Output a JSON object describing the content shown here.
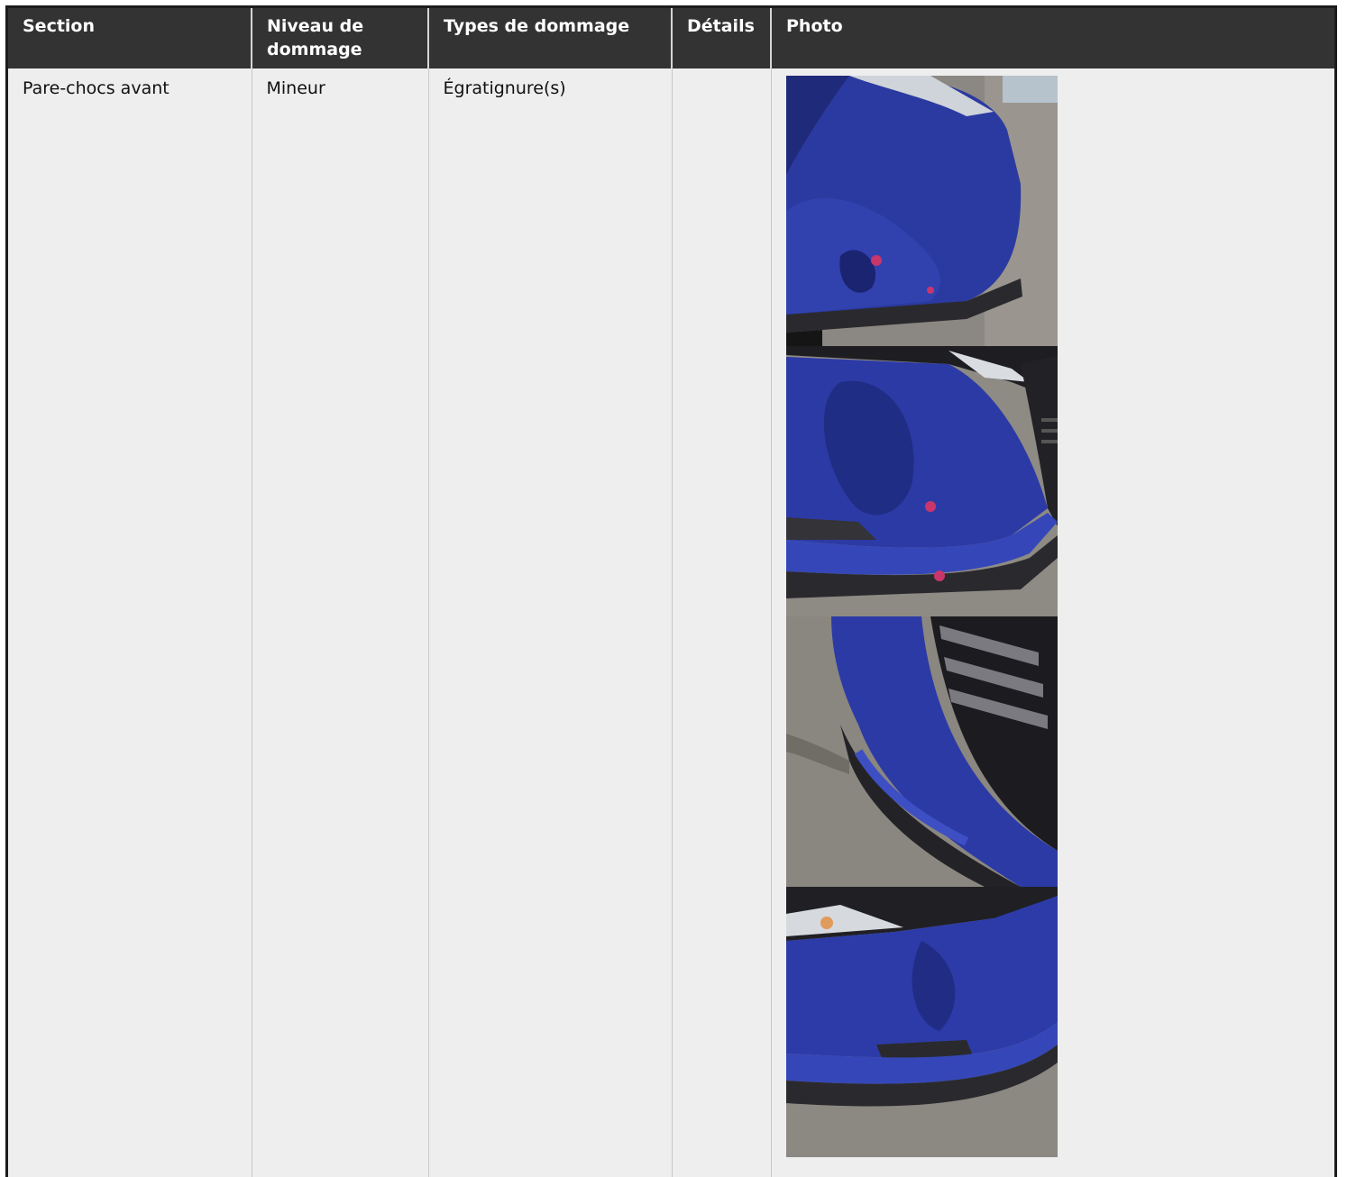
{
  "table": {
    "headers": [
      "Section",
      "Niveau de dommage",
      "Types de dommage",
      "Détails",
      "Photo"
    ],
    "rows": [
      {
        "section": "Pare-chocs avant",
        "niveau": "Mineur",
        "types": "Égratignure(s)",
        "details": "",
        "photos": [
          "car-photo",
          "car-photo",
          "car-photo",
          "car-photo"
        ]
      }
    ]
  },
  "colors": {
    "header_bg": "#333333",
    "cell_bg": "#eeeeee",
    "car_paint": "#2b3aa0",
    "asphalt": "#8e8a84"
  }
}
